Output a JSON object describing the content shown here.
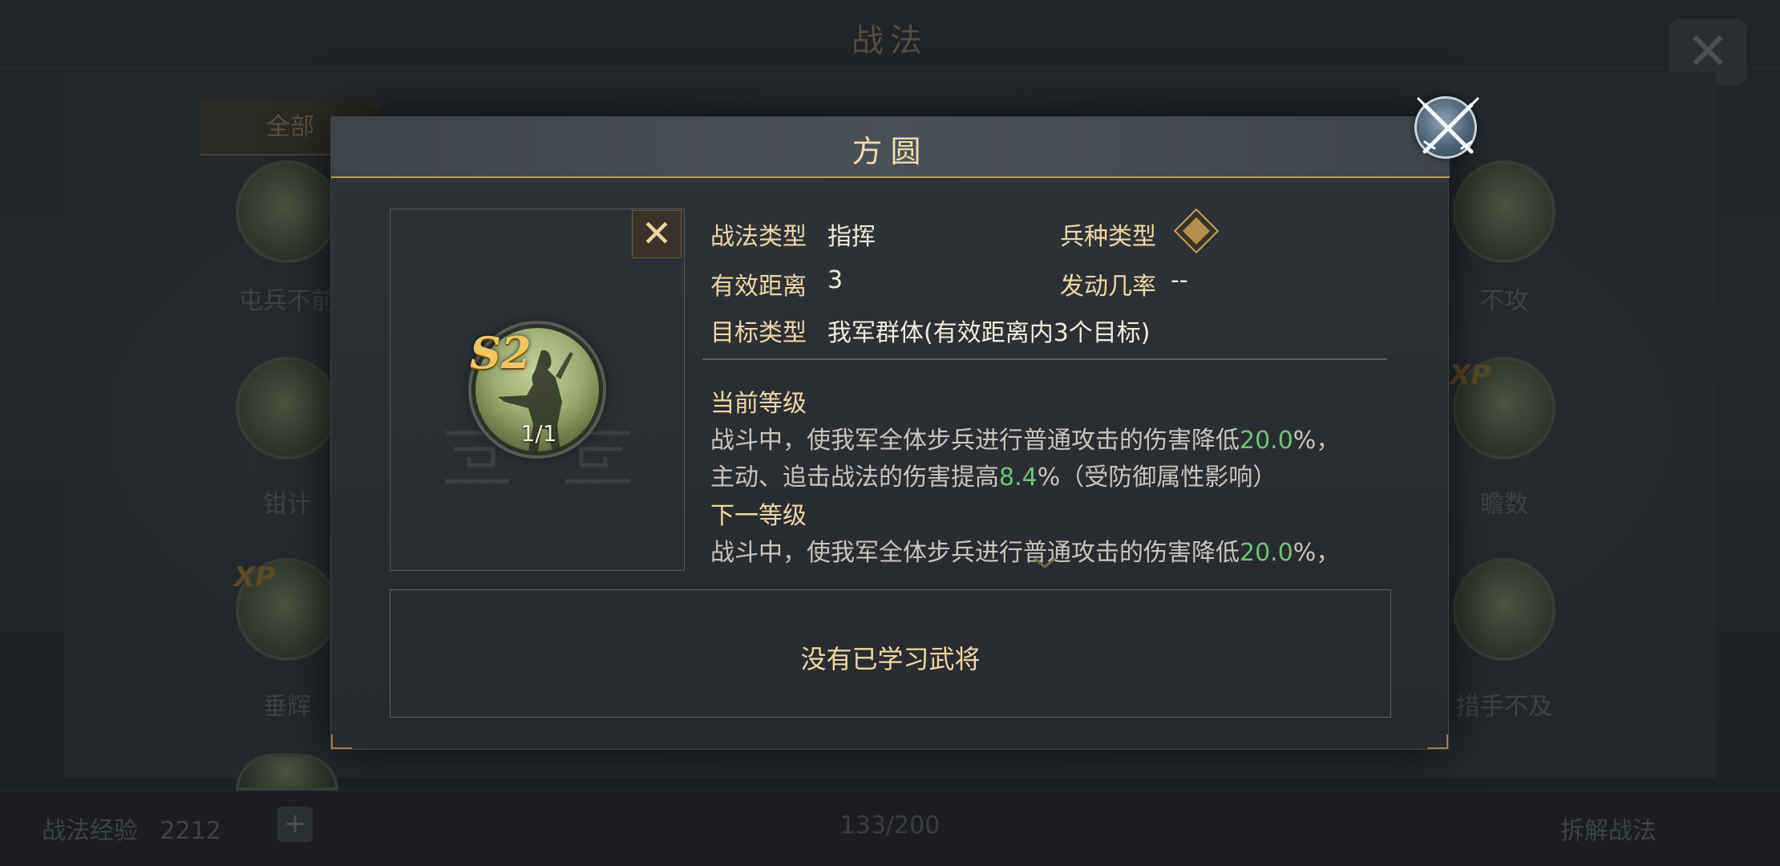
{
  "background": {
    "title": "战法",
    "tab_all": "全部",
    "skills": [
      {
        "name": "屯兵不前"
      },
      {
        "name": "不攻"
      },
      {
        "name": "钳计"
      },
      {
        "name": "瞻数"
      },
      {
        "name": "垂辉"
      },
      {
        "name": "措手不及"
      }
    ],
    "xp_badge": "XP",
    "experience_label": "战法经验",
    "experience_value": "2212",
    "plus": "+",
    "capacity": "133/200",
    "break_label": "拆解战法"
  },
  "dialog": {
    "title": "方圆",
    "skill": {
      "grade": "S2",
      "level": "1/1"
    },
    "info": {
      "type_label": "战法类型",
      "type_value": "指挥",
      "troop_label": "兵种类型",
      "range_label": "有效距离",
      "range_value": "3",
      "rate_label": "发动几率",
      "rate_value": "--",
      "target_label": "目标类型",
      "target_value": "我军群体(有效距离内3个目标)"
    },
    "current": {
      "title": "当前等级",
      "line1_pre": "战斗中，使我军全体步兵进行普通攻击的伤害降低",
      "line1_val": "20.0",
      "line1_post": "%，",
      "line2_pre": "主动、追击战法的伤害提高",
      "line2_val": "8.4",
      "line2_post": "%（受防御属性影响）"
    },
    "next": {
      "title": "下一等级",
      "line1_pre": "战斗中，使我军全体步兵进行普通攻击的伤害降低",
      "line1_val": "20.0",
      "line1_post": "%，"
    },
    "generals_empty": "没有已学习武将"
  },
  "colors": {
    "gold": "#f0d8a4",
    "highlight_green": "#6fc476",
    "accent_border": "#b8985a"
  },
  "icons": {
    "close_dialog": "crossed-swords-icon",
    "close_card": "close-x-icon",
    "troop": "infantry-shield-icon",
    "scroll": "chevron-down-icon"
  }
}
